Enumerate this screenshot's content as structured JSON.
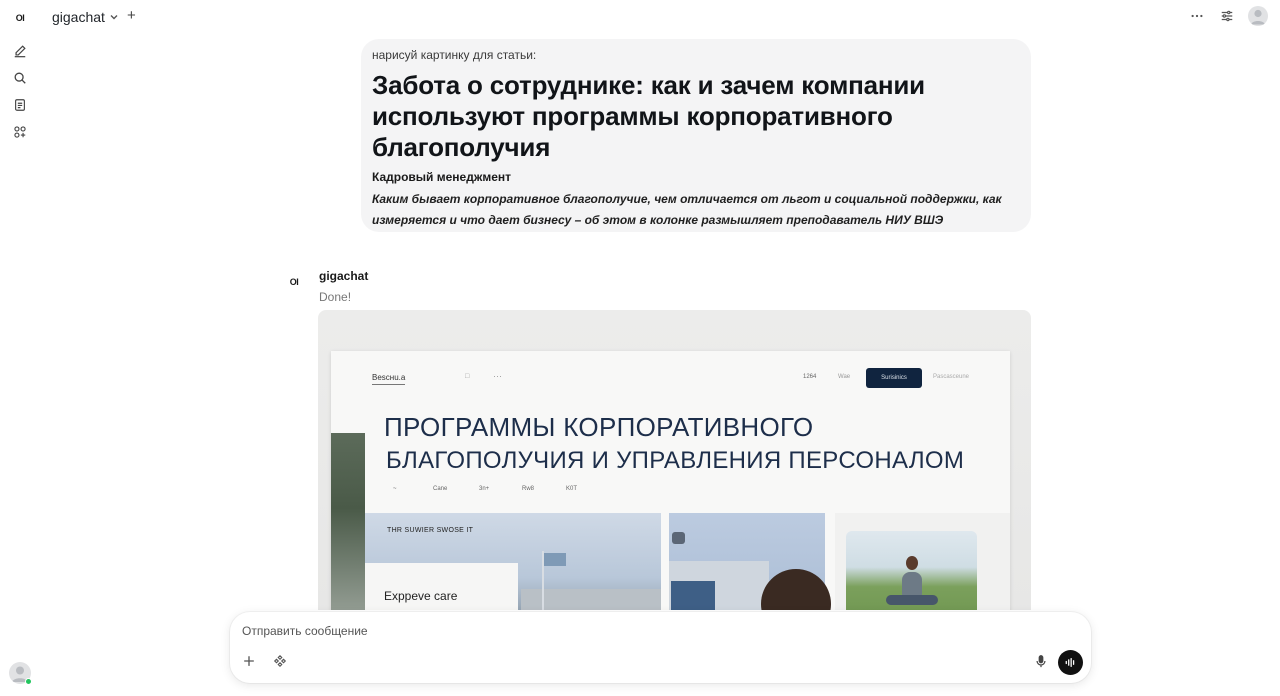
{
  "sidebar": {
    "logo": "OI",
    "icons": [
      "new-chat-icon",
      "search-icon",
      "notes-icon",
      "workspace-icon"
    ],
    "user_online_color": "#22c55e"
  },
  "header": {
    "model_name": "gigachat",
    "icons": [
      "more-icon",
      "controls-icon",
      "user-avatar"
    ]
  },
  "user_message": {
    "prompt": "нарисуй картинку для статьи:",
    "article_title": "Забота о сотруднике: как и зачем компании используют программы корпоративного благополучия",
    "rubric": "Кадровый менеджмент",
    "lead_line1": "Каким бывает корпоративное благополучие, чем отличается от льгот и социальной поддержки, как",
    "lead_line2": "измеряется и что дает бизнесу – об этом в колонке размышляет преподаватель НИУ ВШЭ"
  },
  "assistant": {
    "avatar": "OI",
    "name": "gigachat",
    "status": "Done!"
  },
  "generated_image": {
    "nav_logo": "Bescнu.a",
    "nav_dots": "□",
    "nav_dots2": "···",
    "nav_link1": "1264",
    "nav_link2": "Wae",
    "nav_button": "Surisinics",
    "nav_link3": "Pascasceune",
    "headline_line1": "ПРОГРАММЫ КОРПОРАТИВНОГО",
    "headline_line2": "БЛАГОПОЛУЧИЯ И УПРАВЛЕНИЯ ПЕРСОНАЛОМ",
    "sub1": "~",
    "sub2": "Cane",
    "sub3": "3n+",
    "sub4": "Rw8",
    "sub5": "K0T",
    "card1_label": "THR SUWIER SWOSE IТ",
    "card1_title": "Exppeve care",
    "accent_color": "#10243f",
    "headline_color": "#1d2e4a"
  },
  "composer": {
    "placeholder": "Отправить сообщение",
    "icons": [
      "plus-icon",
      "tools-icon",
      "microphone-icon",
      "voice-mode-icon"
    ],
    "send_color": "#111111"
  }
}
